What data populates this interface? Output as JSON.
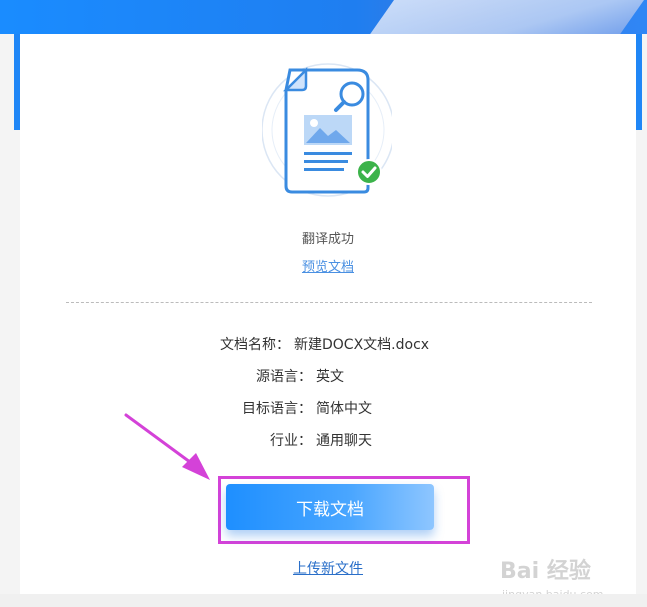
{
  "status": {
    "message": "翻译成功",
    "preview_link": "预览文档"
  },
  "info": {
    "rows": [
      {
        "label": "文档名称：",
        "value": "新建DOCX文档.docx"
      },
      {
        "label": "源语言：",
        "value": "英文"
      },
      {
        "label": "目标语言：",
        "value": "简体中文"
      },
      {
        "label": "行业：",
        "value": "通用聊天"
      }
    ]
  },
  "actions": {
    "download_label": "下载文档",
    "upload_link": "上传新文件"
  },
  "watermark": {
    "text": "Bai 经验",
    "subtext": "jingyan.baidu.com"
  },
  "colors": {
    "accent": "#1e8fff",
    "highlight_box": "#d442d8",
    "arrow": "#d442d8",
    "success": "#3cb34a"
  }
}
